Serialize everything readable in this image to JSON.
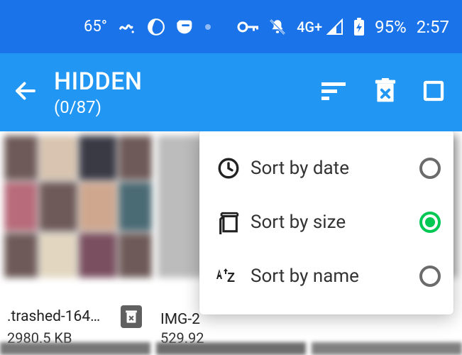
{
  "statusbar": {
    "temperature": "65°",
    "network": "4G+",
    "battery": "95%",
    "time": "2:57"
  },
  "actionbar": {
    "title": "HIDDEN",
    "subtitle": "(0/87)"
  },
  "files": [
    {
      "name": ".trashed-164…",
      "size": "2980.5  KB"
    },
    {
      "name": "IMG-2",
      "size": "529.92"
    }
  ],
  "menu": {
    "items": [
      {
        "label": "Sort by date",
        "selected": false
      },
      {
        "label": "Sort by size",
        "selected": true
      },
      {
        "label": "Sort by name",
        "selected": false
      }
    ]
  },
  "colors": {
    "statusbar": "#1a73e8",
    "actionbar": "#2196f3",
    "accent": "#00c853"
  }
}
